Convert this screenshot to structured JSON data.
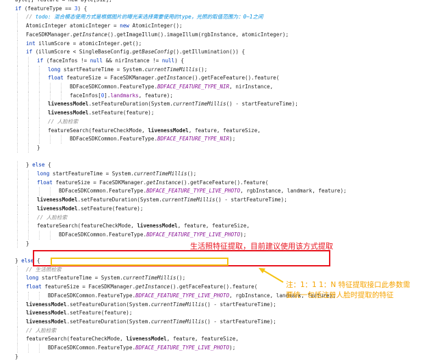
{
  "lines": [
    {
      "indent": 0,
      "tokens": [
        {
          "t": "byte[] feature = new byte[512];"
        }
      ]
    },
    {
      "indent": 0,
      "tokens": [
        {
          "t": "if",
          "c": "kw"
        },
        {
          "t": " (featureType == "
        },
        {
          "t": "3",
          "c": "num"
        },
        {
          "t": ") {"
        }
      ]
    },
    {
      "indent": 1,
      "tokens": [
        {
          "t": "// ",
          "c": "cm"
        },
        {
          "t": "todo",
          "c": "todo"
        },
        {
          "t": ": 混合模态使用方式是根据图片的曝光来选择需要使用的type，光照的取值范围为：0~1之间",
          "c": "todo"
        }
      ]
    },
    {
      "indent": 1,
      "tokens": [
        {
          "t": "AtomicInteger atomicInteger = "
        },
        {
          "t": "new",
          "c": "kw"
        },
        {
          "t": " AtomicInteger();"
        }
      ]
    },
    {
      "indent": 1,
      "tokens": [
        {
          "t": "FaceSDKManager."
        },
        {
          "t": "getInstance",
          "c": "it"
        },
        {
          "t": "().getImageIllum().imageIllum(rgbInstance, atomicInteger);"
        }
      ]
    },
    {
      "indent": 1,
      "tokens": [
        {
          "t": "int",
          "c": "kw"
        },
        {
          "t": " illumScore = atomicInteger.get();"
        }
      ]
    },
    {
      "indent": 1,
      "tokens": [
        {
          "t": "if",
          "c": "kw"
        },
        {
          "t": " (illumScore < SingleBaseConfig."
        },
        {
          "t": "getBaseConfig",
          "c": "it"
        },
        {
          "t": "().getIllumination()) {"
        }
      ]
    },
    {
      "indent": 2,
      "tokens": [
        {
          "t": "if",
          "c": "kw"
        },
        {
          "t": " (faceInfos != "
        },
        {
          "t": "null",
          "c": "kw"
        },
        {
          "t": " && nirInstance != "
        },
        {
          "t": "null",
          "c": "kw"
        },
        {
          "t": ") {"
        }
      ]
    },
    {
      "indent": 3,
      "tokens": [
        {
          "t": "long",
          "c": "kw"
        },
        {
          "t": " startFeatureTime = System."
        },
        {
          "t": "currentTimeMillis",
          "c": "it"
        },
        {
          "t": "();"
        }
      ]
    },
    {
      "indent": 3,
      "tokens": [
        {
          "t": "float",
          "c": "kw"
        },
        {
          "t": " featureSize = FaceSDKManager."
        },
        {
          "t": "getInstance",
          "c": "it"
        },
        {
          "t": "().getFaceFeature().feature("
        }
      ]
    },
    {
      "indent": 5,
      "tokens": [
        {
          "t": "BDFaceSDKCommon.FeatureType."
        },
        {
          "t": "BDFACE_FEATURE_TYPE_NIR",
          "c": "cn"
        },
        {
          "t": ", nirInstance,"
        }
      ]
    },
    {
      "indent": 5,
      "tokens": [
        {
          "t": "faceInfos["
        },
        {
          "t": "0",
          "c": "num"
        },
        {
          "t": "]."
        },
        {
          "t": "landmarks",
          "c": "mem"
        },
        {
          "t": ", feature);"
        }
      ]
    },
    {
      "indent": 3,
      "tokens": [
        {
          "t": "livenessModel",
          "c": "bold"
        },
        {
          "t": ".setFeatureDuration(System."
        },
        {
          "t": "currentTimeMillis",
          "c": "it"
        },
        {
          "t": "() - startFeatureTime);"
        }
      ]
    },
    {
      "indent": 3,
      "tokens": [
        {
          "t": "livenessModel",
          "c": "bold"
        },
        {
          "t": ".setFeature(feature);"
        }
      ]
    },
    {
      "indent": 3,
      "tokens": [
        {
          "t": "// 人脸检索",
          "c": "cm"
        }
      ]
    },
    {
      "indent": 3,
      "tokens": [
        {
          "t": "featureSearch(featureCheckMode, "
        },
        {
          "t": "livenessModel",
          "c": "bold"
        },
        {
          "t": ", feature, featureSize,"
        }
      ]
    },
    {
      "indent": 5,
      "tokens": [
        {
          "t": "BDFaceSDKCommon.FeatureType."
        },
        {
          "t": "BDFACE_FEATURE_TYPE_NIR",
          "c": "cn"
        },
        {
          "t": ");"
        }
      ]
    },
    {
      "indent": 2,
      "tokens": [
        {
          "t": "}"
        }
      ]
    },
    {
      "indent": 0,
      "tokens": [
        {
          "t": ""
        }
      ]
    },
    {
      "indent": 1,
      "tokens": [
        {
          "t": "} "
        },
        {
          "t": "else",
          "c": "kw"
        },
        {
          "t": " {"
        }
      ]
    },
    {
      "indent": 2,
      "tokens": [
        {
          "t": "long",
          "c": "kw"
        },
        {
          "t": " startFeatureTime = System."
        },
        {
          "t": "currentTimeMillis",
          "c": "it"
        },
        {
          "t": "();"
        }
      ]
    },
    {
      "indent": 2,
      "tokens": [
        {
          "t": "float",
          "c": "kw"
        },
        {
          "t": " featureSize = FaceSDKManager."
        },
        {
          "t": "getInstance",
          "c": "it"
        },
        {
          "t": "().getFaceFeature().feature("
        }
      ]
    },
    {
      "indent": 4,
      "tokens": [
        {
          "t": "BDFaceSDKCommon.FeatureType."
        },
        {
          "t": "BDFACE_FEATURE_TYPE_LIVE_PHOTO",
          "c": "cn"
        },
        {
          "t": ", rgbInstance, landmark, feature);"
        }
      ]
    },
    {
      "indent": 2,
      "tokens": [
        {
          "t": "livenessModel",
          "c": "bold"
        },
        {
          "t": ".setFeatureDuration(System."
        },
        {
          "t": "currentTimeMillis",
          "c": "it"
        },
        {
          "t": "() - startFeatureTime);"
        }
      ]
    },
    {
      "indent": 2,
      "tokens": [
        {
          "t": "livenessModel",
          "c": "bold"
        },
        {
          "t": ".setFeature(feature);"
        }
      ]
    },
    {
      "indent": 2,
      "tokens": [
        {
          "t": "// 人脸检索",
          "c": "cm"
        }
      ]
    },
    {
      "indent": 2,
      "tokens": [
        {
          "t": "featureSearch(featureCheckMode, "
        },
        {
          "t": "livenessModel",
          "c": "bold"
        },
        {
          "t": ", feature, featureSize,"
        }
      ]
    },
    {
      "indent": 4,
      "tokens": [
        {
          "t": "BDFaceSDKCommon.FeatureType."
        },
        {
          "t": "BDFACE_FEATURE_TYPE_LIVE_PHOTO",
          "c": "cn"
        },
        {
          "t": ");"
        }
      ]
    },
    {
      "indent": 1,
      "tokens": [
        {
          "t": "}"
        }
      ]
    },
    {
      "indent": 0,
      "tokens": [
        {
          "t": ""
        }
      ]
    },
    {
      "indent": 0,
      "tokens": [
        {
          "t": "} "
        },
        {
          "t": "else",
          "c": "kw"
        },
        {
          "t": " {"
        }
      ]
    },
    {
      "indent": 1,
      "tokens": [
        {
          "t": "// 生活照检索",
          "c": "cm"
        }
      ]
    },
    {
      "indent": 1,
      "tokens": [
        {
          "t": "long",
          "c": "kw"
        },
        {
          "t": " startFeatureTime = System."
        },
        {
          "t": "currentTimeMillis",
          "c": "it"
        },
        {
          "t": "();"
        }
      ]
    },
    {
      "indent": 1,
      "tokens": [
        {
          "t": "float",
          "c": "kw"
        },
        {
          "t": " featureSize = FaceSDKManager."
        },
        {
          "t": "getInstance",
          "c": "it"
        },
        {
          "t": "().getFaceFeature().feature("
        }
      ]
    },
    {
      "indent": 3,
      "tokens": [
        {
          "t": "BDFaceSDKCommon.FeatureType."
        },
        {
          "t": "BDFACE_FEATURE_TYPE_LIVE_PHOTO",
          "c": "cn"
        },
        {
          "t": ", rgbInstance, landmark, feature);"
        }
      ]
    },
    {
      "indent": 1,
      "tokens": [
        {
          "t": "livenessModel",
          "c": "bold"
        },
        {
          "t": ".setFeatureDuration(System."
        },
        {
          "t": "currentTimeMillis",
          "c": "it"
        },
        {
          "t": "() - startFeatureTime);"
        }
      ]
    },
    {
      "indent": 1,
      "tokens": [
        {
          "t": "livenessModel",
          "c": "bold"
        },
        {
          "t": ".setFeature(feature);"
        }
      ]
    },
    {
      "indent": 1,
      "tokens": [
        {
          "t": "livenessModel",
          "c": "bold"
        },
        {
          "t": ".setFeatureDuration(System."
        },
        {
          "t": "currentTimeMillis",
          "c": "it"
        },
        {
          "t": "() - startFeatureTime);"
        }
      ]
    },
    {
      "indent": 1,
      "tokens": [
        {
          "t": "// 人脸检索",
          "c": "cm"
        }
      ]
    },
    {
      "indent": 1,
      "tokens": [
        {
          "t": "featureSearch(featureCheckMode, "
        },
        {
          "t": "livenessModel",
          "c": "bold"
        },
        {
          "t": ", feature, featureSize,"
        }
      ]
    },
    {
      "indent": 3,
      "tokens": [
        {
          "t": "BDFaceSDKCommon.FeatureType."
        },
        {
          "t": "BDFACE_FEATURE_TYPE_LIVE_PHOTO",
          "c": "cn"
        },
        {
          "t": ");"
        }
      ]
    },
    {
      "indent": 0,
      "tokens": [
        {
          "t": "}"
        }
      ]
    }
  ],
  "annotations": {
    "red_note": "生活照特征提取，目前建议使用该方式提取",
    "yellow_note_line1": "注：1：1  1：N  特征提取接口此参数需",
    "yellow_note_line2": "要统一包括注册人脸时提取的特征",
    "red_color": "#e8141e",
    "yellow_color": "#f5a300"
  }
}
